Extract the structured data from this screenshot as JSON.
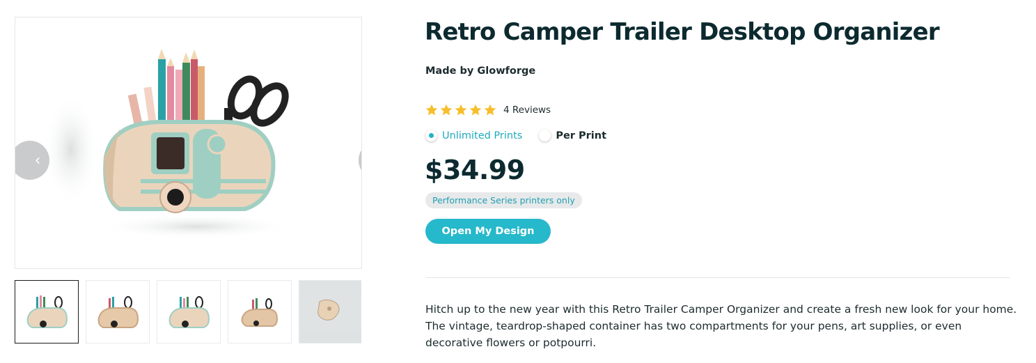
{
  "product": {
    "title": "Retro Camper Trailer Desktop Organizer",
    "maker": "Made by Glowforge",
    "rating": {
      "stars": 5,
      "max": 5,
      "reviews_label": "4 Reviews"
    },
    "pricing_options": [
      {
        "label": "Unlimited Prints",
        "selected": true
      },
      {
        "label": "Per Print",
        "selected": false
      }
    ],
    "price": "$34.99",
    "compatibility_badge": "Performance Series printers only",
    "cta_label": "Open My Design",
    "description": "Hitch up to the new year with this Retro Trailer Camper Organizer and create a fresh new look for your home. The vintage, teardrop-shaped container has two compartments for your pens, art supplies, or even decorative flowers or potpourri."
  },
  "gallery": {
    "prev_icon": "chevron-left-icon",
    "next_icon": "chevron-right-icon",
    "thumbnail_count": 5,
    "active_thumbnail": 0
  },
  "colors": {
    "accent": "#26b8cb",
    "star": "#f7be2b",
    "text": "#0c2a2f",
    "badge_bg": "#e8e9ea"
  }
}
